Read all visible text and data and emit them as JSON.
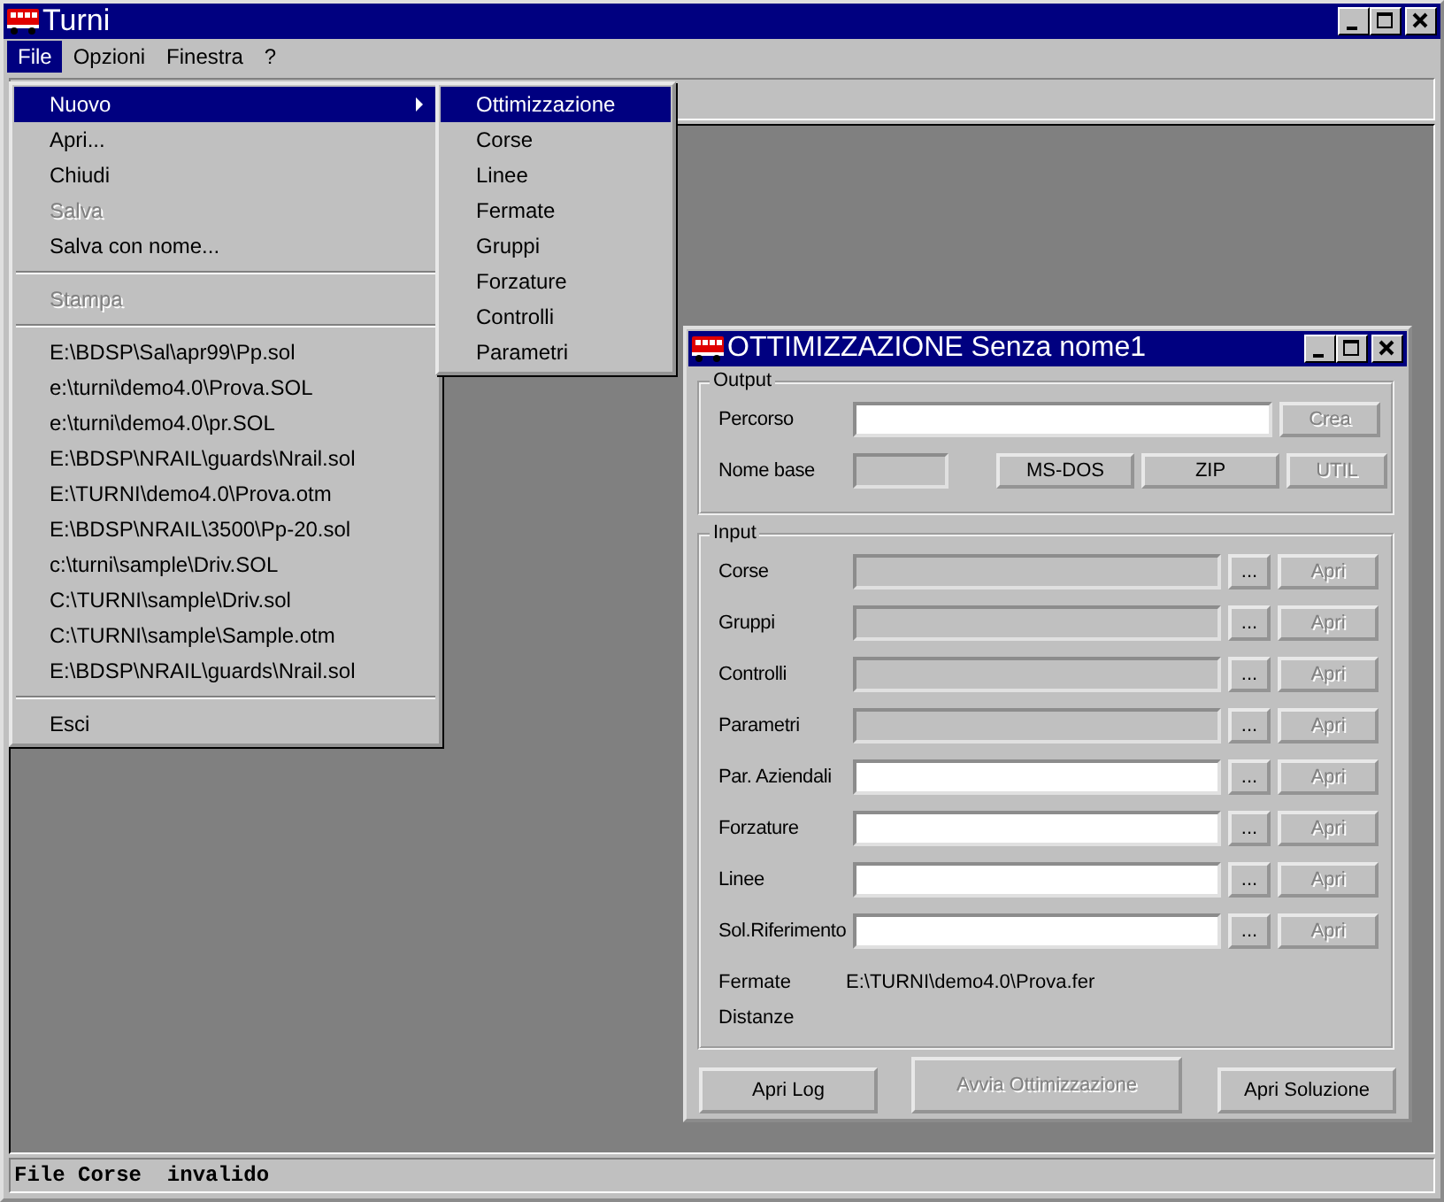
{
  "window": {
    "title": "Turni"
  },
  "menu_bar": [
    {
      "label": "File",
      "selected": true
    },
    {
      "label": "Opzioni",
      "selected": false
    },
    {
      "label": "Finestra",
      "selected": false
    },
    {
      "label": "?",
      "selected": false
    }
  ],
  "file_menu": [
    {
      "kind": "item",
      "label": "Nuovo",
      "selected": true,
      "disabled": false,
      "submenu": true
    },
    {
      "kind": "item",
      "label": "Apri...",
      "selected": false,
      "disabled": false,
      "submenu": false
    },
    {
      "kind": "item",
      "label": "Chiudi",
      "selected": false,
      "disabled": false,
      "submenu": false
    },
    {
      "kind": "item",
      "label": "Salva",
      "selected": false,
      "disabled": true,
      "submenu": false
    },
    {
      "kind": "item",
      "label": "Salva con nome...",
      "selected": false,
      "disabled": false,
      "submenu": false
    },
    {
      "kind": "separator"
    },
    {
      "kind": "item",
      "label": "Stampa",
      "selected": false,
      "disabled": true,
      "submenu": false
    },
    {
      "kind": "separator"
    },
    {
      "kind": "item",
      "label": "E:\\BDSP\\Sal\\apr99\\Pp.sol",
      "selected": false,
      "disabled": false,
      "submenu": false
    },
    {
      "kind": "item",
      "label": "e:\\turni\\demo4.0\\Prova.SOL",
      "selected": false,
      "disabled": false,
      "submenu": false
    },
    {
      "kind": "item",
      "label": "e:\\turni\\demo4.0\\pr.SOL",
      "selected": false,
      "disabled": false,
      "submenu": false
    },
    {
      "kind": "item",
      "label": "E:\\BDSP\\NRAIL\\guards\\Nrail.sol",
      "selected": false,
      "disabled": false,
      "submenu": false
    },
    {
      "kind": "item",
      "label": "E:\\TURNI\\demo4.0\\Prova.otm",
      "selected": false,
      "disabled": false,
      "submenu": false
    },
    {
      "kind": "item",
      "label": "E:\\BDSP\\NRAIL\\3500\\Pp-20.sol",
      "selected": false,
      "disabled": false,
      "submenu": false
    },
    {
      "kind": "item",
      "label": "c:\\turni\\sample\\Driv.SOL",
      "selected": false,
      "disabled": false,
      "submenu": false
    },
    {
      "kind": "item",
      "label": "C:\\TURNI\\sample\\Driv.sol",
      "selected": false,
      "disabled": false,
      "submenu": false
    },
    {
      "kind": "item",
      "label": "C:\\TURNI\\sample\\Sample.otm",
      "selected": false,
      "disabled": false,
      "submenu": false
    },
    {
      "kind": "item",
      "label": "E:\\BDSP\\NRAIL\\guards\\Nrail.sol",
      "selected": false,
      "disabled": false,
      "submenu": false
    },
    {
      "kind": "separator"
    },
    {
      "kind": "item",
      "label": "Esci",
      "selected": false,
      "disabled": false,
      "submenu": false
    }
  ],
  "submenu": [
    {
      "label": "Ottimizzazione",
      "selected": true
    },
    {
      "label": "Corse",
      "selected": false
    },
    {
      "label": "Linee",
      "selected": false
    },
    {
      "label": "Fermate",
      "selected": false
    },
    {
      "label": "Gruppi",
      "selected": false
    },
    {
      "label": "Forzature",
      "selected": false
    },
    {
      "label": "Controlli",
      "selected": false
    },
    {
      "label": "Parametri",
      "selected": false
    }
  ],
  "child_window": {
    "title": "OTTIMIZZAZIONE Senza nome1",
    "output": {
      "legend": "Output",
      "percorso": {
        "label": "Percorso",
        "disabled": false,
        "button": {
          "label": "Crea",
          "disabled": true
        }
      },
      "nome_base": {
        "label": "Nome base",
        "disabled": true
      },
      "buttons": [
        {
          "label": "MS-DOS",
          "disabled": false
        },
        {
          "label": "ZIP",
          "disabled": false
        },
        {
          "label": "UTIL",
          "disabled": true
        }
      ]
    },
    "input": {
      "legend": "Input",
      "rows": [
        {
          "label": "Corse",
          "disabled": true,
          "browse": "...",
          "open": {
            "label": "Apri",
            "disabled": true
          }
        },
        {
          "label": "Gruppi",
          "disabled": true,
          "browse": "...",
          "open": {
            "label": "Apri",
            "disabled": true
          }
        },
        {
          "label": "Controlli",
          "disabled": true,
          "browse": "...",
          "open": {
            "label": "Apri",
            "disabled": true
          }
        },
        {
          "label": "Parametri",
          "disabled": true,
          "browse": "...",
          "open": {
            "label": "Apri",
            "disabled": true
          }
        },
        {
          "label": "Par. Aziendali",
          "disabled": false,
          "browse": "...",
          "open": {
            "label": "Apri",
            "disabled": true
          }
        },
        {
          "label": "Forzature",
          "disabled": false,
          "browse": "...",
          "open": {
            "label": "Apri",
            "disabled": true
          }
        },
        {
          "label": "Linee",
          "disabled": false,
          "browse": "...",
          "open": {
            "label": "Apri",
            "disabled": true
          }
        },
        {
          "label": "Sol.Riferimento",
          "disabled": false,
          "browse": "...",
          "open": {
            "label": "Apri",
            "disabled": true
          }
        }
      ],
      "info": [
        {
          "label": "Fermate",
          "value": "E:\\TURNI\\demo4.0\\Prova.fer"
        },
        {
          "label": "Distanze"
        }
      ]
    },
    "buttons": [
      {
        "label": "Apri Log",
        "disabled": false
      },
      {
        "label": "Avvia Ottimizzazione",
        "disabled": true
      },
      {
        "label": "Apri Soluzione",
        "disabled": false
      }
    ]
  },
  "status_bar": {
    "text": "File Corse  invalido"
  }
}
